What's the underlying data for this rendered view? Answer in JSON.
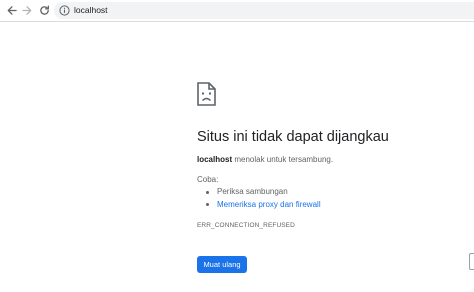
{
  "toolbar": {
    "back_icon": "arrow-left-icon",
    "forward_icon": "arrow-right-icon",
    "reload_icon": "reload-icon",
    "info_icon": "info-icon",
    "url": "localhost"
  },
  "error": {
    "icon": "sad-page-icon",
    "heading": "Situs ini tidak dapat dijangkau",
    "host": "localhost",
    "summary_rest": " menolak untuk tersambung.",
    "try_label": "Coba:",
    "suggestions": [
      {
        "text": "Periksa sambungan",
        "is_link": false
      },
      {
        "text": "Memeriksa proxy dan firewall",
        "is_link": true
      }
    ],
    "code": "ERR_CONNECTION_REFUSED",
    "reload_label": "Muat ulang"
  },
  "colors": {
    "accent": "#1a73e8",
    "heading_text": "#202124",
    "body_text": "#5f6368",
    "omnibox_bg": "#f1f3f4"
  }
}
